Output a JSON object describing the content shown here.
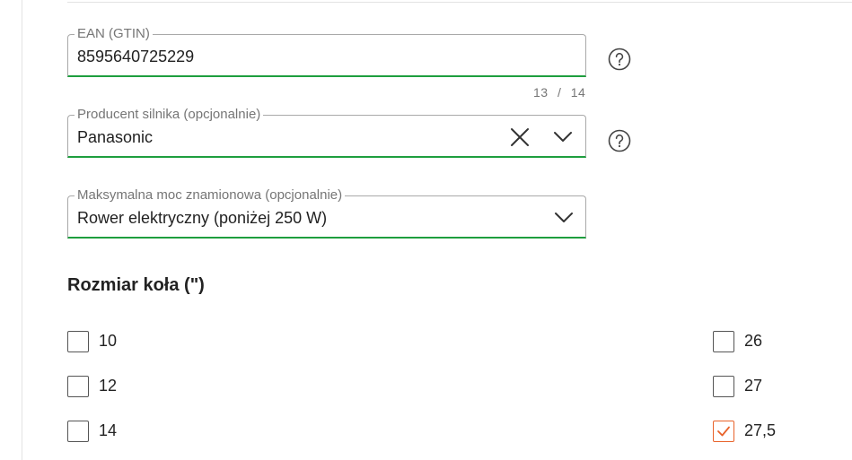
{
  "ean_field": {
    "label": "EAN (GTIN)",
    "value": "8595640725229",
    "counter_current": "13",
    "counter_sep": "/",
    "counter_max": "14"
  },
  "motor_field": {
    "label": "Producent silnika (opcjonalnie)",
    "value": "Panasonic"
  },
  "power_field": {
    "label": "Maksymalna moc znamionowa (opcjonalnie)",
    "value": "Rower elektryczny (poniżej 250 W)"
  },
  "wheel_size": {
    "title": "Rozmiar koła (\")",
    "options": [
      {
        "label": "10",
        "checked": false
      },
      {
        "label": "12",
        "checked": false
      },
      {
        "label": "14",
        "checked": false
      },
      {
        "label": "26",
        "checked": false
      },
      {
        "label": "27",
        "checked": false
      },
      {
        "label": "27,5",
        "checked": true
      }
    ]
  },
  "colors": {
    "valid_border": "#1e9e3e",
    "checkbox_checked": "#e8622a"
  }
}
